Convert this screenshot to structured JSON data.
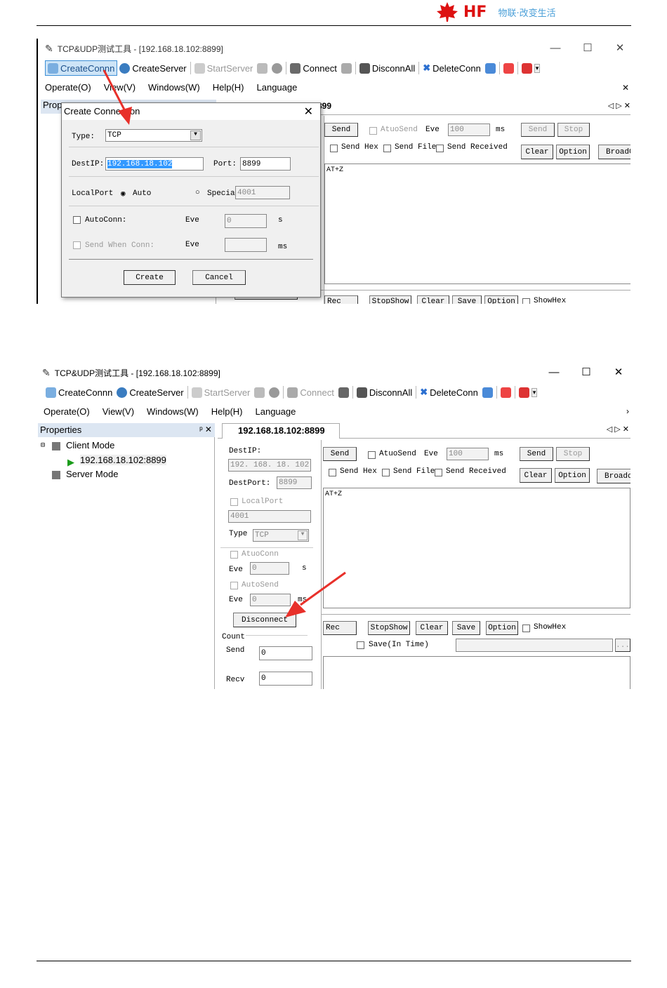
{
  "header": {
    "brand": "HF",
    "slogan": "物联·改变生活"
  },
  "top": {
    "window_title": "TCP&UDP测试工具 - [192.168.18.102:8899]",
    "toolbar": {
      "create_conn": "CreateConnn",
      "create_server": "CreateServer",
      "start_server": "StartServer",
      "connect": "Connect",
      "disconn_all": "DisconnAll",
      "delete_conn": "DeleteConn"
    },
    "menu": {
      "operate": "Operate(O)",
      "view": "View(V)",
      "windows": "Windows(W)",
      "help": "Help(H)",
      "language": "Language"
    },
    "props_stub": "Prop",
    "tab_stub": "899",
    "right": {
      "send": "Send",
      "autosend": "AtuoSend",
      "eve": "Eve",
      "interval": "100",
      "ms": "ms",
      "send2": "Send",
      "stop": "Stop",
      "send_hex": "Send Hex",
      "send_file": "Send File",
      "send_received": "Send Received",
      "clear": "Clear",
      "option": "Option",
      "broad": "BroadC",
      "send_text": "AT+Z",
      "rec": "Rec",
      "stopshow": "StopShow",
      "clear2": "Clear",
      "save": "Save",
      "option2": "Option",
      "showhex": "ShowHex"
    },
    "dialog": {
      "title": "Create Connection",
      "type_label": "Type:",
      "type_value": "TCP",
      "destip_label": "DestIP:",
      "destip_value": "192.168.18.102",
      "port_label": "Port:",
      "port_value": "8899",
      "localport_label": "LocalPort",
      "auto": "Auto",
      "special": "Specia",
      "special_value": "4001",
      "autoconn": "AutoConn:",
      "eve1": "Eve",
      "eve1_value": "0",
      "s": "s",
      "send_when_conn": "Send When Conn:",
      "eve2": "Eve",
      "ms": "ms",
      "create": "Create",
      "cancel": "Cancel"
    }
  },
  "bottom": {
    "window_title": "TCP&UDP测试工具 - [192.168.18.102:8899]",
    "toolbar": {
      "create_conn": "CreateConnn",
      "create_server": "CreateServer",
      "start_server": "StartServer",
      "connect": "Connect",
      "disconn_all": "DisconnAll",
      "delete_conn": "DeleteConn"
    },
    "menu": {
      "operate": "Operate(O)",
      "view": "View(V)",
      "windows": "Windows(W)",
      "help": "Help(H)",
      "language": "Language"
    },
    "properties": "Properties",
    "tree": {
      "client_mode": "Client Mode",
      "client_item": "192.168.18.102:8899",
      "server_mode": "Server Mode"
    },
    "tab": "192.168.18.102:8899",
    "conn": {
      "destip_label": "DestIP:",
      "destip_value": "192. 168. 18. 102",
      "destport_label": "DestPort:",
      "destport_value": "8899",
      "localport": "LocalPort",
      "localport_value": "4001",
      "type_label": "Type",
      "type_value": "TCP",
      "atuoconn": "AtuoConn",
      "eve1": "Eve",
      "eve1_value": "0",
      "s": "s",
      "autosend": "AutoSend",
      "eve2": "Eve",
      "eve2_value": "0",
      "ms": "ms",
      "disconnect": "Disconnect",
      "count": "Count",
      "send": "Send",
      "send_value": "0",
      "recv": "Recv",
      "recv_value": "0"
    },
    "right": {
      "send": "Send",
      "autosend": "AtuoSend",
      "eve": "Eve",
      "interval": "100",
      "ms": "ms",
      "send2": "Send",
      "stop": "Stop",
      "send_hex": "Send Hex",
      "send_file": "Send File",
      "send_received": "Send Received",
      "clear": "Clear",
      "option": "Option",
      "broad": "Broadc",
      "send_text": "AT+Z",
      "rec": "Rec",
      "stopshow": "StopShow",
      "clear2": "Clear",
      "save": "Save",
      "option2": "Option",
      "showhex": "ShowHex",
      "save_in_time": "Save(In Time)",
      "browse": "..."
    }
  },
  "colors": {
    "brand_red": "#d11111",
    "slogan_blue": "#4a9fd8",
    "arrow_red": "#e8302a",
    "selection_blue": "#3399ff"
  }
}
